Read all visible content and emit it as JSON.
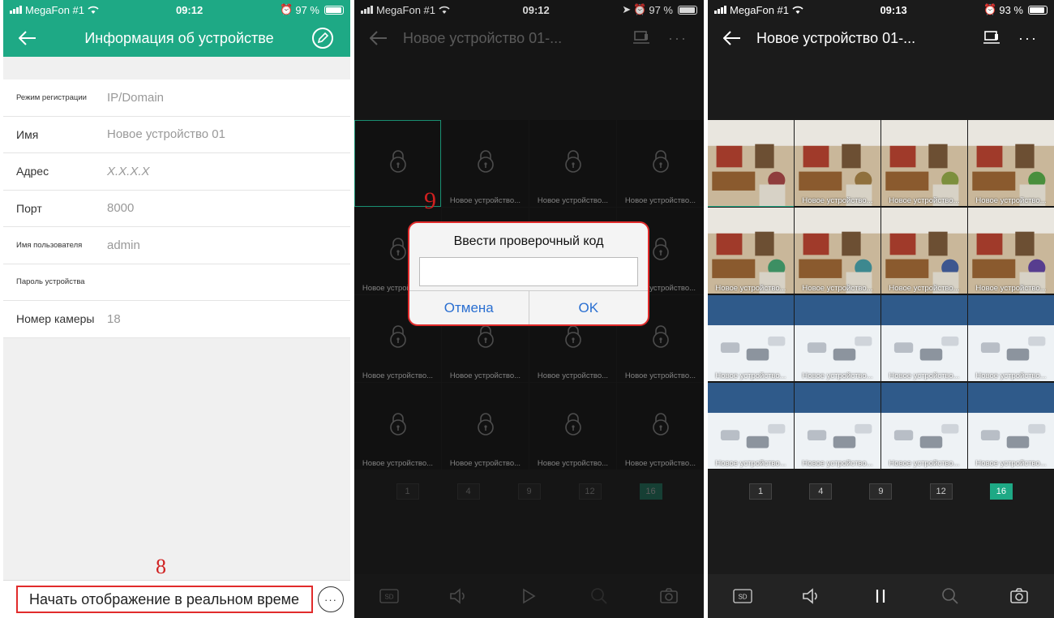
{
  "panel1": {
    "status": {
      "carrier": "MegaFon #1",
      "time": "09:12",
      "battery": "97 %"
    },
    "title": "Информация об устройстве",
    "rows": [
      {
        "label": "Режим регистрации",
        "value": "IP/Domain"
      },
      {
        "label": "Имя",
        "value": "Новое устройство 01"
      },
      {
        "label": "Адрес",
        "value": "X.X.X.X"
      },
      {
        "label": "Порт",
        "value": "8000"
      },
      {
        "label": "Имя пользователя",
        "value": "admin"
      },
      {
        "label": "Пароль устройства",
        "value": ""
      },
      {
        "label": "Номер камеры",
        "value": "18"
      }
    ],
    "start_button": "Начать отображение в реальном време",
    "marker": "8"
  },
  "panel2": {
    "status": {
      "carrier": "MegaFon #1",
      "time": "09:12",
      "battery": "97 %"
    },
    "title": "Новое устройство 01-...",
    "cell_caption": "Новое устройство...",
    "channels": [
      "1",
      "4",
      "9",
      "12",
      "16"
    ],
    "active_channel": "16",
    "dialog": {
      "title": "Ввести проверочный код",
      "input_value": "",
      "cancel": "Отмена",
      "ok": "OK"
    },
    "marker": "9"
  },
  "panel3": {
    "status": {
      "carrier": "MegaFon #1",
      "time": "09:13",
      "battery": "93 %"
    },
    "title": "Новое устройство 01-...",
    "cell_caption": "Новое устройство...",
    "channels": [
      "1",
      "4",
      "9",
      "12",
      "16"
    ],
    "active_channel": "16"
  },
  "toolbar_icons": [
    "sd-icon",
    "speaker-icon",
    "play-pause-icon",
    "zoom-icon",
    "camera-snapshot-icon"
  ],
  "toolbar_sd_label": "SD",
  "colors": {
    "accent": "#1ea985",
    "highlight": "#e12b2b",
    "link": "#2a6fd1"
  }
}
